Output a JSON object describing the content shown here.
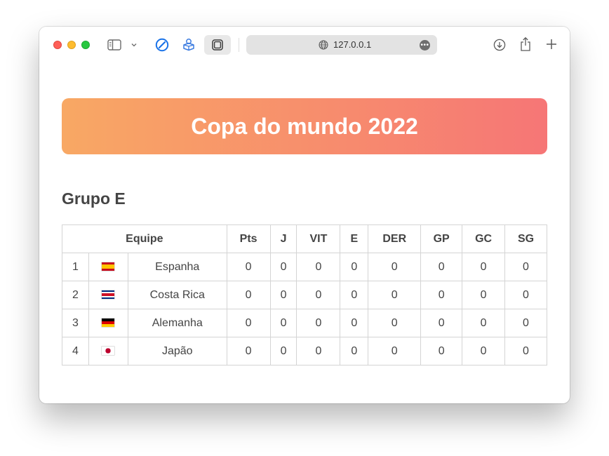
{
  "browser": {
    "url": "127.0.0.1",
    "url_more": "•••"
  },
  "page": {
    "banner_title": "Copa do mundo 2022",
    "group_title": "Grupo E"
  },
  "table": {
    "headers": {
      "team": "Equipe",
      "pts": "Pts",
      "j": "J",
      "vit": "VIT",
      "e": "E",
      "der": "DER",
      "gp": "GP",
      "gc": "GC",
      "sg": "SG"
    },
    "rows": [
      {
        "pos": "1",
        "flag": "flag-spain-icon",
        "team": "Espanha",
        "pts": "0",
        "j": "0",
        "vit": "0",
        "e": "0",
        "der": "0",
        "gp": "0",
        "gc": "0",
        "sg": "0"
      },
      {
        "pos": "2",
        "flag": "flag-costa-rica-icon",
        "team": "Costa Rica",
        "pts": "0",
        "j": "0",
        "vit": "0",
        "e": "0",
        "der": "0",
        "gp": "0",
        "gc": "0",
        "sg": "0"
      },
      {
        "pos": "3",
        "flag": "flag-germany-icon",
        "team": "Alemanha",
        "pts": "0",
        "j": "0",
        "vit": "0",
        "e": "0",
        "der": "0",
        "gp": "0",
        "gc": "0",
        "sg": "0"
      },
      {
        "pos": "4",
        "flag": "flag-japan-icon",
        "team": "Japão",
        "pts": "0",
        "j": "0",
        "vit": "0",
        "e": "0",
        "der": "0",
        "gp": "0",
        "gc": "0",
        "sg": "0"
      }
    ]
  },
  "colors": {
    "banner_start": "#f8a864",
    "banner_end": "#f67676",
    "text": "#444444"
  }
}
